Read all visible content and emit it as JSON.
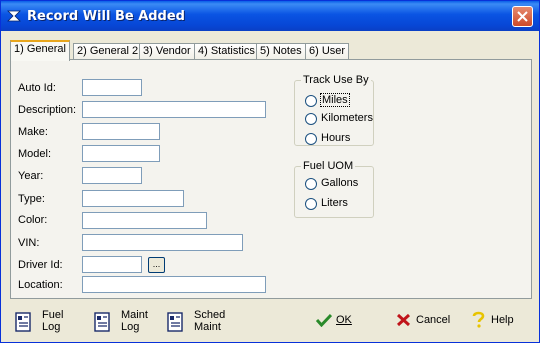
{
  "window": {
    "title": "Record Will Be Added"
  },
  "tabs": [
    {
      "label": "1) General"
    },
    {
      "label": "2) General 2"
    },
    {
      "label": "3) Vendor"
    },
    {
      "label": "4) Statistics"
    },
    {
      "label": "5) Notes"
    },
    {
      "label": "6) User"
    }
  ],
  "fields": {
    "auto_id": {
      "label": "Auto Id:",
      "value": ""
    },
    "description": {
      "label": "Description:",
      "value": ""
    },
    "make": {
      "label": "Make:",
      "value": ""
    },
    "model": {
      "label": "Model:",
      "value": ""
    },
    "year": {
      "label": "Year:",
      "value": ""
    },
    "type": {
      "label": "Type:",
      "value": ""
    },
    "color": {
      "label": "Color:",
      "value": ""
    },
    "vin": {
      "label": "VIN:",
      "value": ""
    },
    "driver_id": {
      "label": "Driver Id:",
      "value": "",
      "lookup_label": "..."
    },
    "location": {
      "label": "Location:",
      "value": ""
    }
  },
  "track_use_by": {
    "title": "Track Use By",
    "options": [
      "Miles",
      "Kilometers",
      "Hours"
    ]
  },
  "fuel_uom": {
    "title": "Fuel UOM",
    "options": [
      "Gallons",
      "Liters"
    ]
  },
  "bottom": {
    "fuel_log": {
      "line1": "Fuel",
      "line2": "Log"
    },
    "maint_log": {
      "line1": "Maint",
      "line2": "Log"
    },
    "sched_maint": {
      "line1": "Sched",
      "line2": "Maint"
    },
    "ok": "OK",
    "cancel": "Cancel",
    "help": "Help"
  },
  "colors": {
    "titlebar": "#0a54e3",
    "tab_highlight": "#e8a61c",
    "ok_check": "#2a8a2a",
    "cancel_x": "#c0141a",
    "help_icon": "#e8c400"
  }
}
